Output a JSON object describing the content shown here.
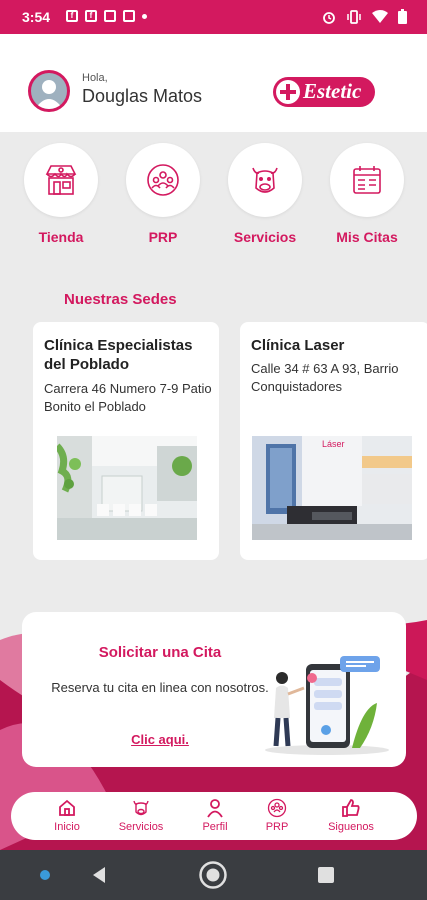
{
  "status_bar": {
    "time": "3:54",
    "left_icons": [
      "facebook-icon",
      "facebook-icon",
      "sim-icon",
      "sim-icon",
      "dot-icon"
    ],
    "right_icons": [
      "alarm-icon",
      "vibrate-icon",
      "wifi-icon",
      "battery-icon"
    ]
  },
  "header": {
    "greeting": "Hola,",
    "user_name": "Douglas Matos",
    "logo_text": "Estetic"
  },
  "categories": [
    {
      "label": "Tienda",
      "icon": "store-icon"
    },
    {
      "label": "PRP",
      "icon": "group-icon"
    },
    {
      "label": "Servicios",
      "icon": "cow-icon"
    },
    {
      "label": "Mis Citas",
      "icon": "calendar-icon"
    }
  ],
  "sedes": {
    "title": "Nuestras Sedes",
    "items": [
      {
        "name": "Clínica Especialistas del Poblado",
        "address": "Carrera 46 Numero 7-9 Patio Bonito el Poblado"
      },
      {
        "name": "Clínica Laser",
        "address": "Calle 34 # 63 A 93, Barrio Conquistadores",
        "photo_text": "Láser"
      }
    ]
  },
  "cita": {
    "title": "Solicitar una Cita",
    "description": "Reserva tu cita en linea con nosotros.",
    "link": "Clic aqui."
  },
  "tabs": [
    {
      "label": "Inicio",
      "icon": "home-icon"
    },
    {
      "label": "Servicios",
      "icon": "cow-icon"
    },
    {
      "label": "Perfil",
      "icon": "person-icon"
    },
    {
      "label": "PRP",
      "icon": "group-icon"
    },
    {
      "label": "Siguenos",
      "icon": "thumbs-up-icon"
    }
  ],
  "colors": {
    "primary": "#d3195f",
    "background": "#ebebeb",
    "nav_bar": "#3a3d41"
  }
}
